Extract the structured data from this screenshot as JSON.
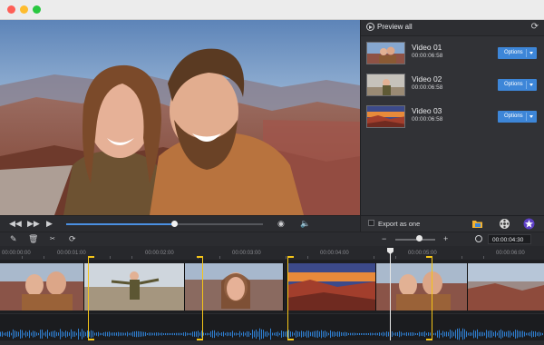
{
  "window": {
    "controls": [
      "close",
      "minimize",
      "zoom"
    ]
  },
  "panel": {
    "preview_all_label": "Preview all",
    "videos": [
      {
        "title": "Video 01",
        "duration": "00:00:06:58",
        "options_label": "Options"
      },
      {
        "title": "Video 02",
        "duration": "00:00:06:58",
        "options_label": "Options"
      },
      {
        "title": "Video 03",
        "duration": "00:00:06:58",
        "options_label": "Options"
      }
    ]
  },
  "player": {
    "progress_fraction": 0.55,
    "icons": [
      "rewind-icon",
      "fast-forward-icon",
      "play-icon",
      "record-icon",
      "volume-icon"
    ]
  },
  "export": {
    "export_as_one_label": "Export as one",
    "export_as_one_checked": false
  },
  "timeline": {
    "zoom_fraction": 0.6,
    "current_time": "00:00:04:30",
    "ticks": [
      "00:00:00:00",
      "00:00:01:00",
      "00:00:02:00",
      "00:00:03:00",
      "00:00:04:00",
      "00:00:05:00",
      "00:00:06:00"
    ],
    "playhead_time": "00:00:05:00"
  },
  "colors": {
    "accent": "#3d86d8",
    "selection": "#f5c518",
    "waveform": "#2f7fd1",
    "background": "#2b2c30"
  }
}
